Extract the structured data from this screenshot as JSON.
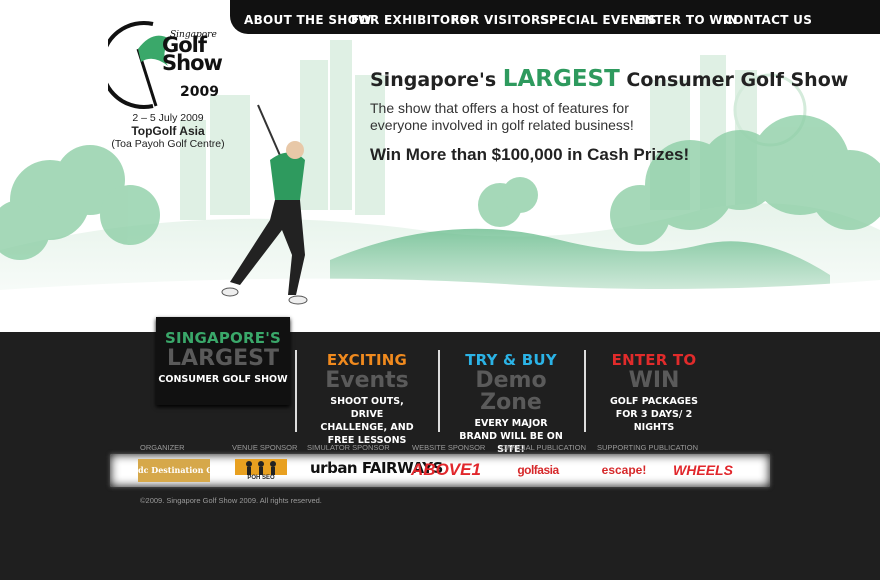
{
  "nav": {
    "items": [
      {
        "label": "ABOUT THE SHOW"
      },
      {
        "label": "FOR EXHIBITORS"
      },
      {
        "label": "FOR VISITORS"
      },
      {
        "label": "SPECIAL EVENTS"
      },
      {
        "label": "ENTER TO WIN"
      },
      {
        "label": "CONTACT US"
      }
    ]
  },
  "logo": {
    "script": "Singapore",
    "line1": "Golf",
    "line2": "Show",
    "year": "2009"
  },
  "event": {
    "dates": "2 – 5 July 2009",
    "venue": "TopGolf Asia",
    "venue_note": "(Toa Payoh Golf Centre)"
  },
  "hero": {
    "headline_pre": "Singapore's ",
    "headline_big": "LARGEST",
    "headline_post": " Consumer Golf Show",
    "tagline": "The show that offers a host of features for everyone involved in golf related business!",
    "prize": "Win More than $100,000 in Cash Prizes!"
  },
  "panels": [
    {
      "title": "SINGAPORE'S",
      "big": "LARGEST",
      "desc": "CONSUMER GOLF SHOW",
      "color": "#3aa86a"
    },
    {
      "title": "EXCITING",
      "big": "Events",
      "desc": "SHOOT OUTS, DRIVE CHALLENGE, AND FREE LESSONS",
      "color": "#f08a1e"
    },
    {
      "title": "TRY & BUY",
      "big": "Demo Zone",
      "desc": "EVERY MAJOR BRAND WILL BE ON SITE!",
      "color": "#2bb3e6"
    },
    {
      "title": "ENTER TO",
      "big": "WIN",
      "desc": "GOLF PACKAGES FOR 3 DAYS/ 2 NIGHTS",
      "color": "#e12b2b"
    }
  ],
  "sponsor_labels": [
    "ORGANIZER",
    "VENUE SPONSOR",
    "SIMULATOR SPONSOR",
    "WEBSITE SPONSOR",
    "OFFICIAL PUBLICATION",
    "SUPPORTING PUBLICATION"
  ],
  "sponsors": [
    {
      "name": "dc Destination Concierge"
    },
    {
      "name": "POH SEO"
    },
    {
      "name": "urban FAIRWAYS"
    },
    {
      "name": "ABOVE1"
    },
    {
      "name": "golfasia"
    },
    {
      "name": "escape!"
    },
    {
      "name": "WHEELS"
    }
  ],
  "footer": {
    "copyright": "©2009. Singapore Golf Show 2009. All rights reserved."
  },
  "colors": {
    "green": "#2e9a5e",
    "orange": "#f08a1e",
    "blue": "#2bb3e6",
    "red": "#e12b2b",
    "dark": "#1f1f1f"
  }
}
